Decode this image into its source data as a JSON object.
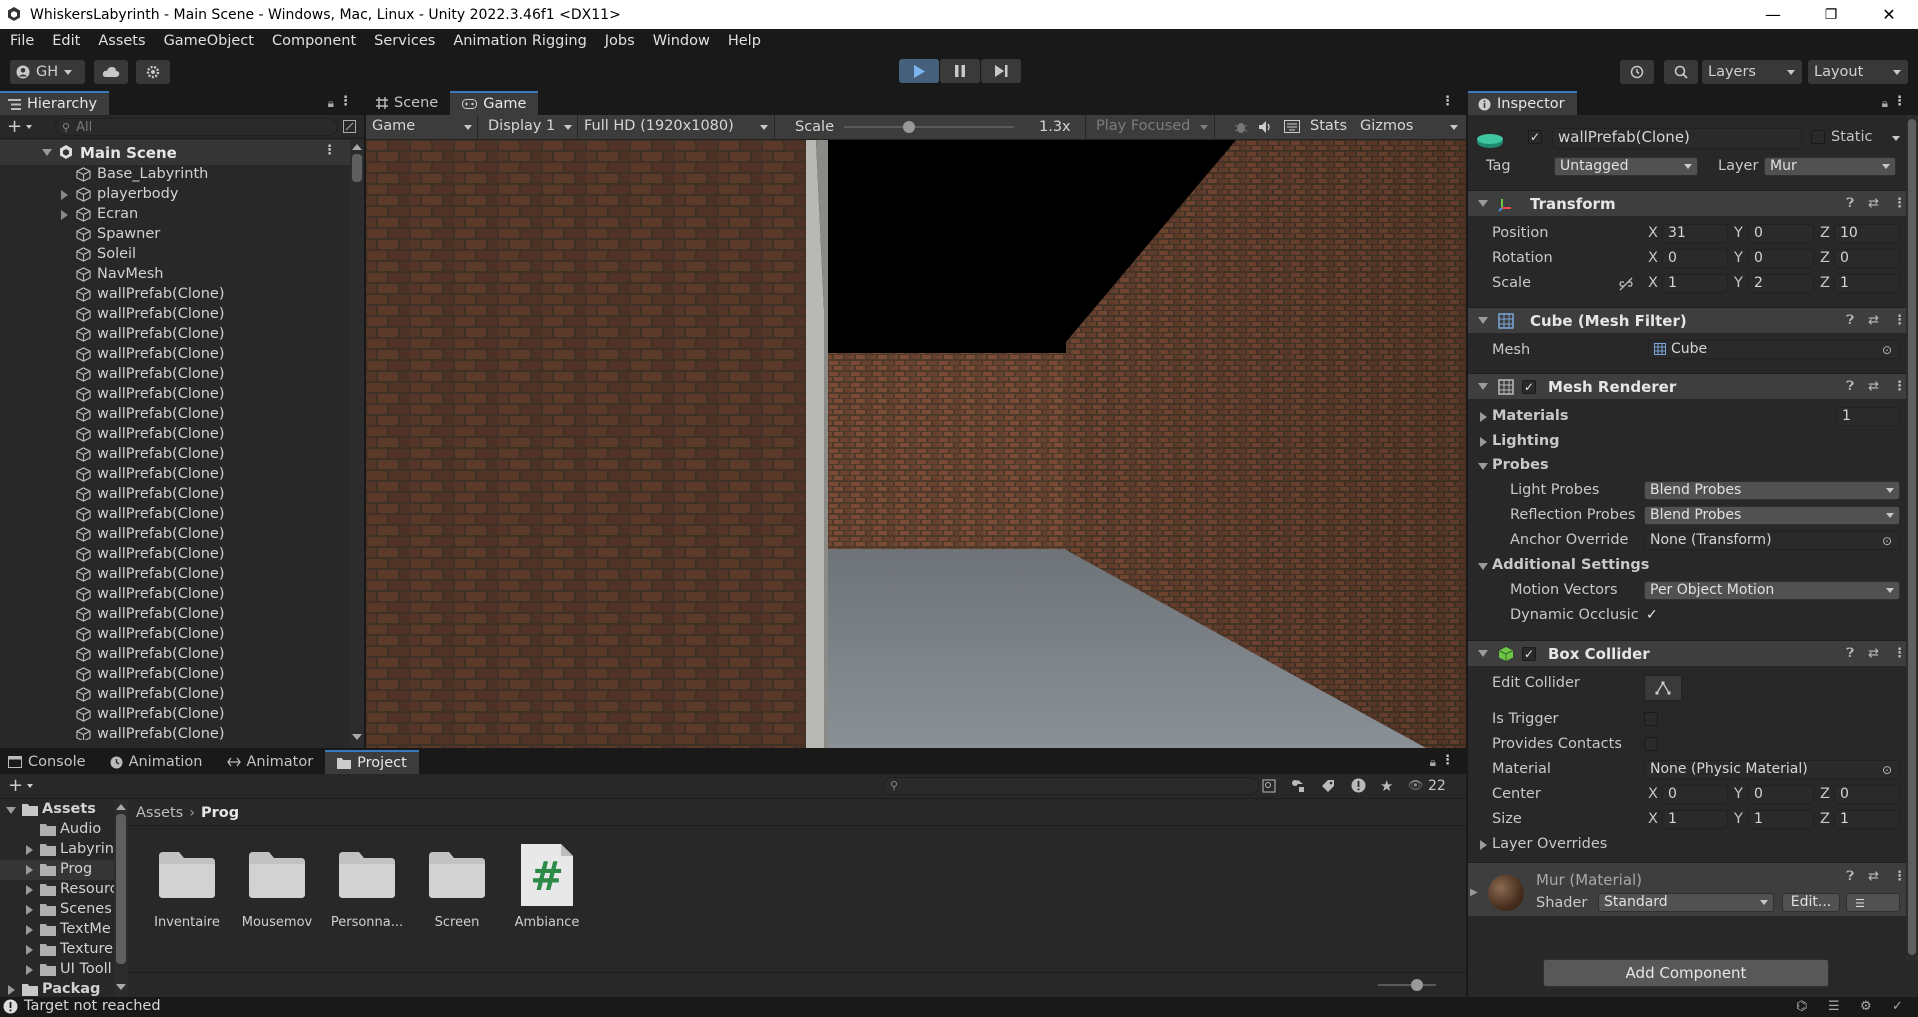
{
  "window": {
    "title": "WhiskersLabyrinth - Main Scene - Windows, Mac, Linux - Unity 2022.3.46f1 <DX11>",
    "min": "—",
    "max": "❐",
    "close": "✕"
  },
  "menu": [
    "File",
    "Edit",
    "Assets",
    "GameObject",
    "Component",
    "Services",
    "Animation Rigging",
    "Jobs",
    "Window",
    "Help"
  ],
  "toolbar": {
    "account": "GH",
    "layers": "Layers",
    "layout": "Layout"
  },
  "hierarchy": {
    "tab": "Hierarchy",
    "search_placeholder": "All",
    "scene": "Main Scene",
    "items": [
      {
        "label": "Base_Labyrinth",
        "expand": false
      },
      {
        "label": "playerbody",
        "expand": true
      },
      {
        "label": "Ecran",
        "expand": true
      },
      {
        "label": "Spawner",
        "expand": false
      },
      {
        "label": "Soleil",
        "expand": false
      },
      {
        "label": "NavMesh",
        "expand": false
      },
      {
        "label": "wallPrefab(Clone)",
        "expand": false
      },
      {
        "label": "wallPrefab(Clone)",
        "expand": false
      },
      {
        "label": "wallPrefab(Clone)",
        "expand": false
      },
      {
        "label": "wallPrefab(Clone)",
        "expand": false
      },
      {
        "label": "wallPrefab(Clone)",
        "expand": false
      },
      {
        "label": "wallPrefab(Clone)",
        "expand": false
      },
      {
        "label": "wallPrefab(Clone)",
        "expand": false
      },
      {
        "label": "wallPrefab(Clone)",
        "expand": false
      },
      {
        "label": "wallPrefab(Clone)",
        "expand": false
      },
      {
        "label": "wallPrefab(Clone)",
        "expand": false
      },
      {
        "label": "wallPrefab(Clone)",
        "expand": false
      },
      {
        "label": "wallPrefab(Clone)",
        "expand": false
      },
      {
        "label": "wallPrefab(Clone)",
        "expand": false
      },
      {
        "label": "wallPrefab(Clone)",
        "expand": false
      },
      {
        "label": "wallPrefab(Clone)",
        "expand": false
      },
      {
        "label": "wallPrefab(Clone)",
        "expand": false
      },
      {
        "label": "wallPrefab(Clone)",
        "expand": false
      },
      {
        "label": "wallPrefab(Clone)",
        "expand": false
      },
      {
        "label": "wallPrefab(Clone)",
        "expand": false
      },
      {
        "label": "wallPrefab(Clone)",
        "expand": false
      },
      {
        "label": "wallPrefab(Clone)",
        "expand": false
      },
      {
        "label": "wallPrefab(Clone)",
        "expand": false
      },
      {
        "label": "wallPrefab(Clone)",
        "expand": false
      }
    ]
  },
  "game": {
    "tabs": [
      "Scene",
      "Game"
    ],
    "mode": "Game",
    "display": "Display 1",
    "resolution": "Full HD (1920x1080)",
    "scale_label": "Scale",
    "scale_value": "1.3x",
    "play_focused": "Play Focused",
    "stats": "Stats",
    "gizmos": "Gizmos"
  },
  "inspector": {
    "tab": "Inspector",
    "object_name": "wallPrefab(Clone)",
    "static": "Static",
    "tag_label": "Tag",
    "tag_value": "Untagged",
    "layer_label": "Layer",
    "layer_value": "Mur",
    "transform": {
      "title": "Transform",
      "position": {
        "label": "Position",
        "x": "31",
        "y": "0",
        "z": "10"
      },
      "rotation": {
        "label": "Rotation",
        "x": "0",
        "y": "0",
        "z": "0"
      },
      "scale": {
        "label": "Scale",
        "x": "1",
        "y": "2",
        "z": "1"
      }
    },
    "mesh_filter": {
      "title": "Cube (Mesh Filter)",
      "mesh_label": "Mesh",
      "mesh_value": "Cube"
    },
    "mesh_renderer": {
      "title": "Mesh Renderer",
      "materials": "Materials",
      "materials_count": "1",
      "lighting": "Lighting",
      "probes": "Probes",
      "light_probes_label": "Light Probes",
      "light_probes_value": "Blend Probes",
      "reflection_probes_label": "Reflection Probes",
      "reflection_probes_value": "Blend Probes",
      "anchor_label": "Anchor Override",
      "anchor_value": "None (Transform)",
      "additional": "Additional Settings",
      "motion_label": "Motion Vectors",
      "motion_value": "Per Object Motion",
      "dynamic_label": "Dynamic Occlusic"
    },
    "box_collider": {
      "title": "Box Collider",
      "edit_collider": "Edit Collider",
      "is_trigger": "Is Trigger",
      "provides_contacts": "Provides Contacts",
      "material_label": "Material",
      "material_value": "None (Physic Material)",
      "center": {
        "label": "Center",
        "x": "0",
        "y": "0",
        "z": "0"
      },
      "size": {
        "label": "Size",
        "x": "1",
        "y": "1",
        "z": "1"
      },
      "layer_overrides": "Layer Overrides"
    },
    "material": {
      "title": "Mur (Material)",
      "shader_label": "Shader",
      "shader_value": "Standard",
      "edit": "Edit..."
    },
    "add_component": "Add Component"
  },
  "bottom": {
    "tabs": [
      "Console",
      "Animation",
      "Animator",
      "Project"
    ],
    "count": "22",
    "tree": [
      {
        "label": "Assets",
        "level": 0,
        "expand": "down"
      },
      {
        "label": "Audio",
        "level": 1,
        "expand": "none"
      },
      {
        "label": "Labyrin",
        "level": 1,
        "expand": "right"
      },
      {
        "label": "Prog",
        "level": 1,
        "expand": "right"
      },
      {
        "label": "Resourc",
        "level": 1,
        "expand": "right"
      },
      {
        "label": "Scenes",
        "level": 1,
        "expand": "right"
      },
      {
        "label": "TextMe",
        "level": 1,
        "expand": "right"
      },
      {
        "label": "Texture",
        "level": 1,
        "expand": "right"
      },
      {
        "label": "UI Tooll",
        "level": 1,
        "expand": "right"
      },
      {
        "label": "Packag",
        "level": 0,
        "expand": "right"
      }
    ],
    "breadcrumb": [
      "Assets",
      "Prog"
    ],
    "files": [
      {
        "name": "Inventaire",
        "type": "folder"
      },
      {
        "name": "Mousemov",
        "type": "folder"
      },
      {
        "name": "Personna...",
        "type": "folder"
      },
      {
        "name": "Screen",
        "type": "folder"
      },
      {
        "name": "Ambiance",
        "type": "script"
      }
    ]
  },
  "status": {
    "message": "Target not reached"
  },
  "colors": {
    "accent": "#3a79bb",
    "play_active": "#46607c",
    "panel": "#282828",
    "header": "#3e3e3e"
  }
}
